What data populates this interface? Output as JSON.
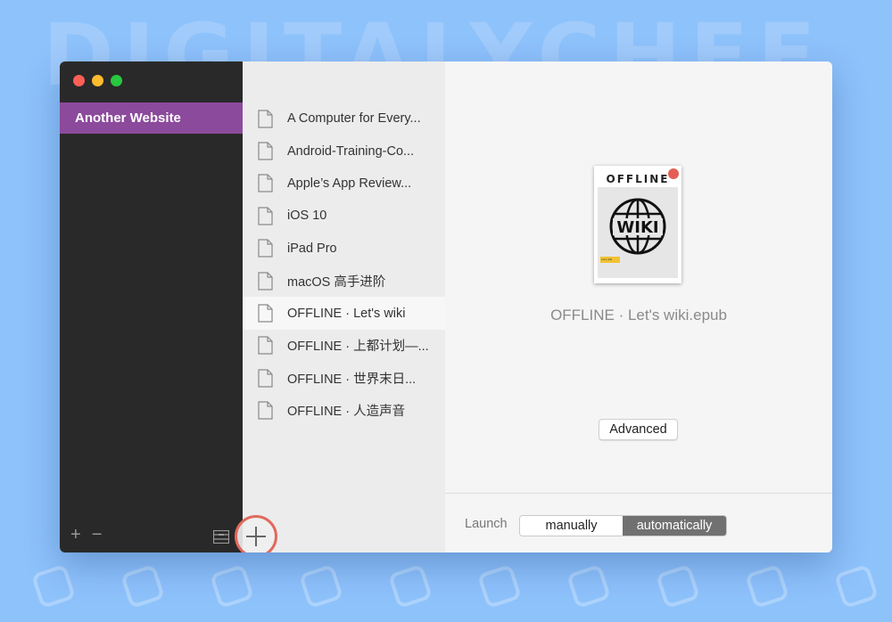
{
  "sidebar": {
    "selected_site": "Another Website",
    "add_label": "+",
    "remove_label": "−"
  },
  "files": [
    {
      "name": "A Computer for Every..."
    },
    {
      "name": "Android-Training-Co..."
    },
    {
      "name": "Apple’s App Review..."
    },
    {
      "name": "iOS 10"
    },
    {
      "name": "iPad Pro"
    },
    {
      "name": "macOS 高手进阶"
    },
    {
      "name": "OFFLINE · Let's wiki",
      "selected": true
    },
    {
      "name": "OFFLINE · 上都计划—..."
    },
    {
      "name": "OFFLINE · 世界末日..."
    },
    {
      "name": "OFFLINE · 人造声音"
    }
  ],
  "detail": {
    "cover_title": "OFFLINE",
    "cover_art_text": "WIKI",
    "cover_tag": "Let's wiki",
    "file_title": "OFFLINE · Let's wiki.epub",
    "advanced_label": "Advanced",
    "launch_label": "Launch",
    "launch_options": [
      "manually",
      "automatically"
    ],
    "launch_selected": "automatically"
  },
  "background": {
    "watermark": "DIGITALYCHEF"
  },
  "colors": {
    "accent_purple": "#8c4a9c",
    "highlight_ring": "#e0695c",
    "background_blue": "#8ec2fb"
  }
}
